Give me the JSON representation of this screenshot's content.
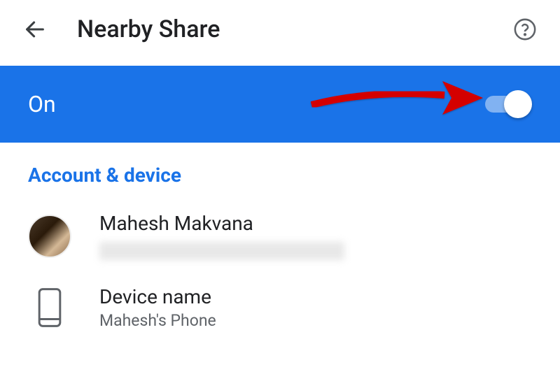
{
  "header": {
    "title": "Nearby Share"
  },
  "toggle": {
    "label": "On",
    "state": true
  },
  "section": {
    "header": "Account & device"
  },
  "account": {
    "name": "Mahesh Makvana"
  },
  "device": {
    "label": "Device name",
    "value": "Mahesh's Phone"
  }
}
